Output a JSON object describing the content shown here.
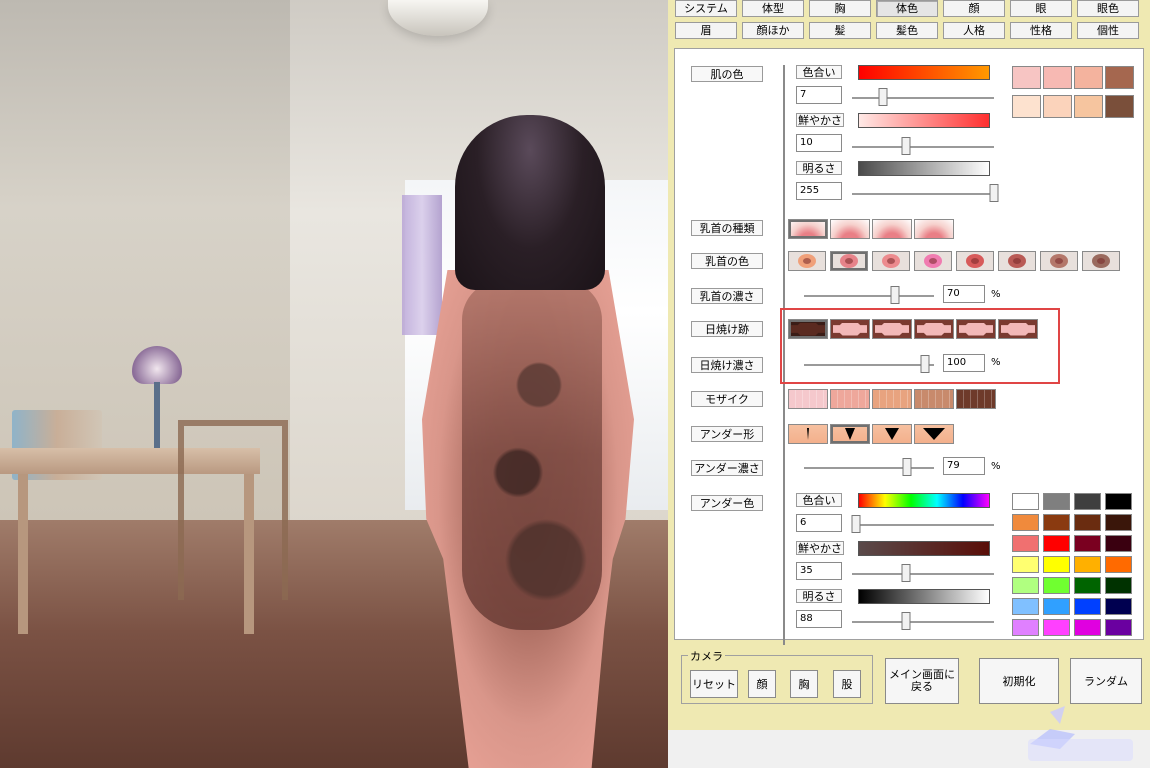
{
  "tabs_row1": [
    "システム",
    "体型",
    "胸",
    "体色",
    "顔",
    "眼",
    "眼色"
  ],
  "tabs_row2": [
    "眉",
    "顔ほか",
    "髪",
    "髪色",
    "人格",
    "性格",
    "個性"
  ],
  "active_tab": "体色",
  "skin": {
    "label": "肌の色",
    "hue": {
      "label": "色合い",
      "value": "7",
      "fraction": 0.22
    },
    "saturation": {
      "label": "鮮やかさ",
      "value": "10",
      "fraction": 0.38
    },
    "brightness": {
      "label": "明るさ",
      "value": "255",
      "fraction": 1.0
    },
    "swatches": [
      "#f7c5c3",
      "#f7b9b3",
      "#f4b39e",
      "#a5674f",
      "#fde2cf",
      "#fbd3bb",
      "#f6c59f",
      "#7a4f3a"
    ]
  },
  "nipple_type": {
    "label": "乳首の種類"
  },
  "nipple_color": {
    "label": "乳首の色",
    "colors": [
      "#f0a07a",
      "#e7838a",
      "#ec8b8e",
      "#f07bb0",
      "#d75a5a",
      "#b95a55",
      "#b4776a",
      "#9a6a5e"
    ]
  },
  "nipple_density": {
    "label": "乳首の濃さ",
    "value": "70",
    "unit": "%",
    "fraction": 0.7
  },
  "tan_mark": {
    "label": "日焼け跡",
    "colors": [
      "#5a2a20",
      "#f2b8b8",
      "#f2b8b8",
      "#f2b8b8",
      "#f2b8b8",
      "#f2b8b8"
    ]
  },
  "tan_density": {
    "label": "日焼け濃さ",
    "value": "100",
    "unit": "%",
    "fraction": 0.93
  },
  "mosaic": {
    "label": "モザイク",
    "colors": [
      "#f5c8cc",
      "#eea79b",
      "#e8a37f",
      "#c88a6c",
      "#6e3a2a"
    ]
  },
  "under_shape": {
    "label": "アンダー形"
  },
  "under_density": {
    "label": "アンダー濃さ",
    "value": "79",
    "unit": "%",
    "fraction": 0.79
  },
  "under_color": {
    "label": "アンダー色",
    "hue": {
      "label": "色合い",
      "value": "6",
      "fraction": 0.03
    },
    "saturation": {
      "label": "鮮やかさ",
      "value": "35",
      "fraction": 0.38
    },
    "brightness": {
      "label": "明るさ",
      "value": "88",
      "fraction": 0.38
    },
    "palette": [
      "#ffffff",
      "#7f7f7f",
      "#3f3f3f",
      "#000000",
      "#f08a3c",
      "#8a3a10",
      "#6a2c10",
      "#3a160a",
      "#f07070",
      "#ff0000",
      "#7a0020",
      "#3a0010",
      "#ffff70",
      "#ffff00",
      "#ffb000",
      "#ff6a00",
      "#b0ff80",
      "#70ff30",
      "#006400",
      "#003200",
      "#80c0ff",
      "#30a0ff",
      "#0040ff",
      "#000050",
      "#e080ff",
      "#ff40ff",
      "#e000e0",
      "#6a00a0"
    ]
  },
  "camera": {
    "label": "カメラ",
    "buttons": [
      "リセット",
      "顔",
      "胸",
      "股"
    ]
  },
  "main_screen": "メイン画面に\n戻る",
  "initialize": "初期化",
  "random": "ランダム",
  "colors": {
    "highlight": "#e04545",
    "panel_frame": "#efe9b2"
  }
}
